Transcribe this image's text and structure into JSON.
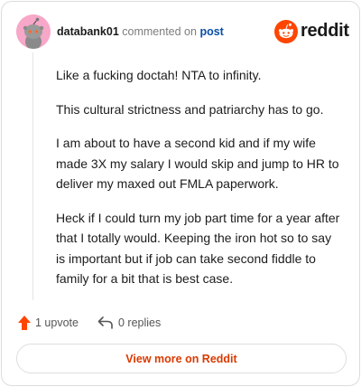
{
  "header": {
    "username": "databank01",
    "action_text": "commented on",
    "post_link": "post",
    "brand_name": "reddit"
  },
  "comment": {
    "paragraphs": [
      "Like a fucking doctah! NTA to infinity.",
      "This cultural strictness and patriarchy has to go.",
      "I am about to have a second kid and if my wife made 3X my salary I would skip and jump to HR to deliver my maxed out FMLA paperwork.",
      "Heck if I could turn my job part time for a year after that I totally would. Keeping the iron hot so to say is important but if job can take second fiddle to family for a bit that is best case."
    ]
  },
  "actions": {
    "upvote_label": "1 upvote",
    "replies_label": "0 replies"
  },
  "footer": {
    "view_more_label": "View more on Reddit"
  },
  "colors": {
    "brand_orange": "#ff4500",
    "link_blue": "#0a4ea5",
    "cta_orange": "#d93a00",
    "avatar_pink": "#f7a7c8"
  },
  "icons": {
    "avatar": "snoo-avatar-icon",
    "logo": "reddit-logo-icon",
    "upvote": "upvote-arrow-icon",
    "reply": "reply-arrow-icon"
  }
}
